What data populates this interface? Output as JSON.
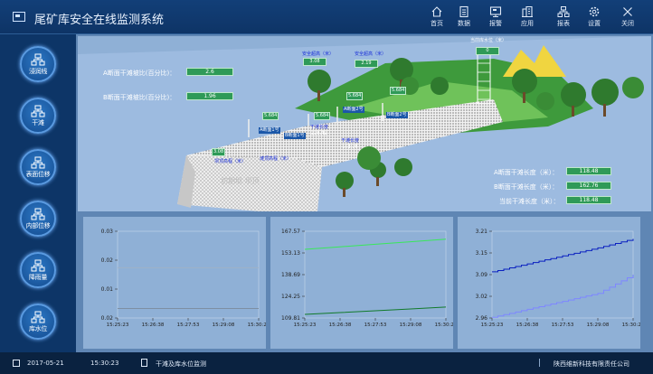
{
  "app": {
    "title": "尾矿库安全在线监测系统"
  },
  "toolbar": [
    {
      "name": "home",
      "label": "首页",
      "icon": "home-icon"
    },
    {
      "name": "data",
      "label": "数据",
      "icon": "document-icon"
    },
    {
      "name": "alarm",
      "label": "报警",
      "icon": "monitor-icon"
    },
    {
      "name": "apps",
      "label": "应用",
      "icon": "building-icon"
    },
    {
      "name": "report",
      "label": "报表",
      "icon": "network-icon"
    },
    {
      "name": "settings",
      "label": "设置",
      "icon": "gear-icon"
    },
    {
      "name": "close",
      "label": "关闭",
      "icon": "close-icon"
    }
  ],
  "sidebar": [
    {
      "label": "浸润线",
      "icon": "sensor-icon"
    },
    {
      "label": "干滩",
      "icon": "sensor-icon"
    },
    {
      "label": "表面位移",
      "icon": "sensor-icon"
    },
    {
      "label": "内部位移",
      "icon": "sensor-icon"
    },
    {
      "label": "降雨量",
      "icon": "sensor-icon"
    },
    {
      "label": "库水位",
      "icon": "sensor-icon"
    }
  ],
  "scene": {
    "a_slope_label": "A断面干滩坡比(百分比)：",
    "a_slope_value": "2.6",
    "b_slope_label": "B断面干滩坡比(百分比)：",
    "b_slope_value": "1.96",
    "a_len_label": "A断面干滩长度（米）：",
    "a_len_value": "118.48",
    "b_len_label": "B断面干滩长度（米）：",
    "b_len_value": "162.76",
    "cur_len_label": "当前干滩长度（米）：",
    "cur_len_value": "118.48",
    "safe_height_label_1": "安全超高（米）",
    "safe_height_value_1": "3.08",
    "safe_height_label_2": "安全超高（米）",
    "safe_height_value_2": "2.19",
    "water_level_label": "当前库水位（米）",
    "water_level_value": "0",
    "gauge_1": "5.684",
    "gauge_2": "5.684",
    "gauge_3": "5.684",
    "gauge_4": "5.684",
    "gauge_5": "3.08",
    "a_sec": "A断面1号",
    "b_sec": "B断面1号",
    "a_sec2": "A断面2号",
    "b_sec2": "B断面2号",
    "dry_len_1": "干滩长度",
    "dry_len_val_1": "118.48",
    "dry_len_2": "干滩长度",
    "dry_len_val_2": "162.76",
    "height_1": "坝顶高程（米）",
    "height_2": "滩顶高程（米）",
    "dam_label": "初期坝 坝顶"
  },
  "chart_data": [
    {
      "type": "line",
      "x": [
        "15:25:23",
        "15:26:38",
        "15:27:53",
        "15:29:08",
        "15:30:23"
      ],
      "yticks": [
        "0.03",
        "0.02",
        "0.01",
        "0.02"
      ],
      "ylim": [
        0.02,
        0.03
      ],
      "series": [
        {
          "values": [
            0.0258,
            0.0258,
            0.0258,
            0.0258,
            0.0258
          ],
          "color": "#9fb2c6"
        },
        {
          "values": [
            0.0211,
            0.0211,
            0.0211,
            0.0211,
            0.0211
          ],
          "color": "#7d8fa3"
        }
      ]
    },
    {
      "type": "line",
      "x": [
        "15:25:23",
        "15:26:38",
        "15:27:53",
        "15:29:08",
        "15:30:23"
      ],
      "yticks": [
        "167.57",
        "153.13",
        "138.69",
        "124.25",
        "109.81"
      ],
      "ylim": [
        109.81,
        167.57
      ],
      "series": [
        {
          "values": [
            155.5,
            157.2,
            158.9,
            160.6,
            162.3
          ],
          "color": "#39e85a"
        },
        {
          "values": [
            112.2,
            113.4,
            114.6,
            115.8,
            117.1
          ],
          "color": "#117a2a"
        }
      ]
    },
    {
      "type": "line",
      "x": [
        "15:25:23",
        "15:26:38",
        "15:27:53",
        "15:29:08",
        "15:30:23"
      ],
      "yticks": [
        "3.21",
        "3.15",
        "3.09",
        "3.02",
        "2.96"
      ],
      "ylim": [
        2.96,
        3.21
      ],
      "series": [
        {
          "values": [
            3.093,
            3.116,
            3.139,
            3.162,
            3.188
          ],
          "color": "#0a1fc0"
        },
        {
          "values": [
            2.962,
            2.985,
            3.008,
            3.031,
            3.085
          ],
          "color": "#7f87ff"
        }
      ]
    }
  ],
  "status": {
    "date": "2017-05-21",
    "time": "15:30:23",
    "module": "干滩及库水位监测",
    "company": "陕西维新科技有限责任公司"
  }
}
